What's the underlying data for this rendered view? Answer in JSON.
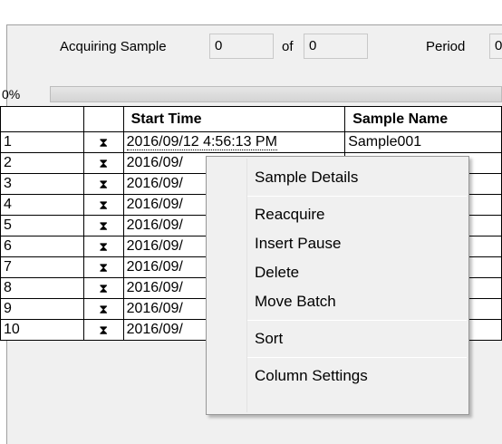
{
  "header": {
    "acquiring_label": "Acquiring Sample",
    "current_sample": "0",
    "of_label": "of",
    "total_samples": "0",
    "period_label": "Period",
    "period_value": "0"
  },
  "progress": {
    "label": "0%",
    "value": 0
  },
  "table": {
    "columns": [
      "",
      "",
      "Start Time",
      "Sample Name"
    ],
    "rows": [
      {
        "index": "1",
        "status_icon": "hourglass-icon",
        "start_time": "2016/09/12 4:56:13 PM",
        "sample_name": "Sample001"
      },
      {
        "index": "2",
        "status_icon": "hourglass-icon",
        "start_time": "2016/09/",
        "sample_name": ""
      },
      {
        "index": "3",
        "status_icon": "hourglass-icon",
        "start_time": "2016/09/",
        "sample_name": ""
      },
      {
        "index": "4",
        "status_icon": "hourglass-icon",
        "start_time": "2016/09/",
        "sample_name": ""
      },
      {
        "index": "5",
        "status_icon": "hourglass-icon",
        "start_time": "2016/09/",
        "sample_name": ""
      },
      {
        "index": "6",
        "status_icon": "hourglass-icon",
        "start_time": "2016/09/",
        "sample_name": ""
      },
      {
        "index": "7",
        "status_icon": "hourglass-icon",
        "start_time": "2016/09/",
        "sample_name": ""
      },
      {
        "index": "8",
        "status_icon": "hourglass-icon",
        "start_time": "2016/09/",
        "sample_name": ""
      },
      {
        "index": "9",
        "status_icon": "hourglass-icon",
        "start_time": "2016/09/",
        "sample_name": ""
      },
      {
        "index": "10",
        "status_icon": "hourglass-icon",
        "start_time": "2016/09/",
        "sample_name": ""
      }
    ]
  },
  "context_menu": {
    "items": [
      "Sample Details",
      "Reacquire",
      "Insert Pause",
      "Delete",
      "Move Batch",
      "Sort",
      "Column Settings"
    ]
  }
}
